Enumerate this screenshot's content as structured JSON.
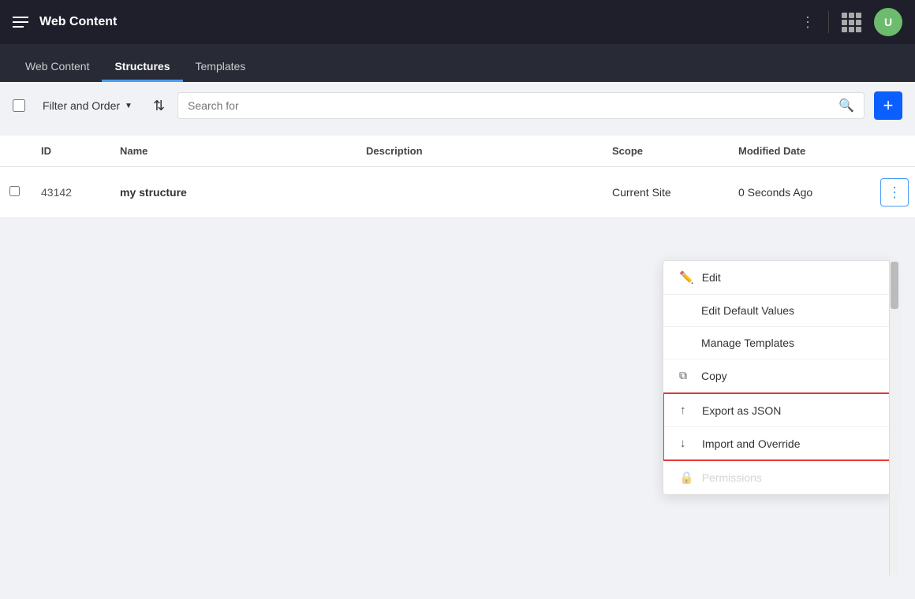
{
  "app": {
    "title": "Web Content",
    "avatar_initials": "U"
  },
  "nav": {
    "tabs": [
      {
        "label": "Web Content",
        "active": false
      },
      {
        "label": "Structures",
        "active": true
      },
      {
        "label": "Templates",
        "active": false
      }
    ]
  },
  "toolbar": {
    "filter_label": "Filter and Order",
    "search_placeholder": "Search for",
    "add_label": "+"
  },
  "table": {
    "columns": [
      "",
      "ID",
      "Name",
      "Description",
      "Scope",
      "Modified Date",
      ""
    ],
    "rows": [
      {
        "id": "43142",
        "name": "my structure",
        "description": "",
        "scope": "Current Site",
        "modified_date": "0 Seconds Ago"
      }
    ]
  },
  "dropdown": {
    "items": [
      {
        "icon": "✏️",
        "label": "Edit",
        "has_icon": true,
        "highlighted": false
      },
      {
        "icon": "",
        "label": "Edit Default Values",
        "has_icon": false,
        "highlighted": false
      },
      {
        "icon": "",
        "label": "Manage Templates",
        "has_icon": false,
        "highlighted": false
      },
      {
        "icon": "⧉",
        "label": "Copy",
        "has_icon": true,
        "highlighted": false
      },
      {
        "icon": "↑",
        "label": "Export as JSON",
        "has_icon": true,
        "highlighted": true
      },
      {
        "icon": "↓",
        "label": "Import and Override",
        "has_icon": true,
        "highlighted": true
      },
      {
        "icon": "🔒",
        "label": "Permissions",
        "has_icon": true,
        "highlighted": false
      }
    ]
  }
}
